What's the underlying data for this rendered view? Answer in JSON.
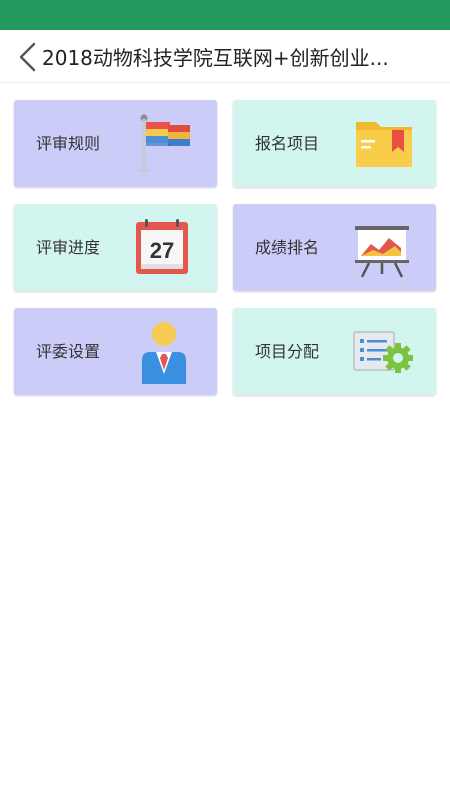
{
  "header": {
    "title": "2018动物科技学院互联网+创新创业..."
  },
  "menu": {
    "items": [
      {
        "label": "评审规则",
        "icon": "flag-icon"
      },
      {
        "label": "报名项目",
        "icon": "folder-icon"
      },
      {
        "label": "评审进度",
        "icon": "calendar-icon"
      },
      {
        "label": "成绩排名",
        "icon": "presentation-chart-icon"
      },
      {
        "label": "评委设置",
        "icon": "person-icon"
      },
      {
        "label": "项目分配",
        "icon": "list-settings-icon"
      }
    ],
    "calendar_day": "27"
  },
  "colors": {
    "status_bar": "#23995f",
    "tile_purple": "#ccccf9",
    "tile_mint": "#d2f6ef"
  }
}
